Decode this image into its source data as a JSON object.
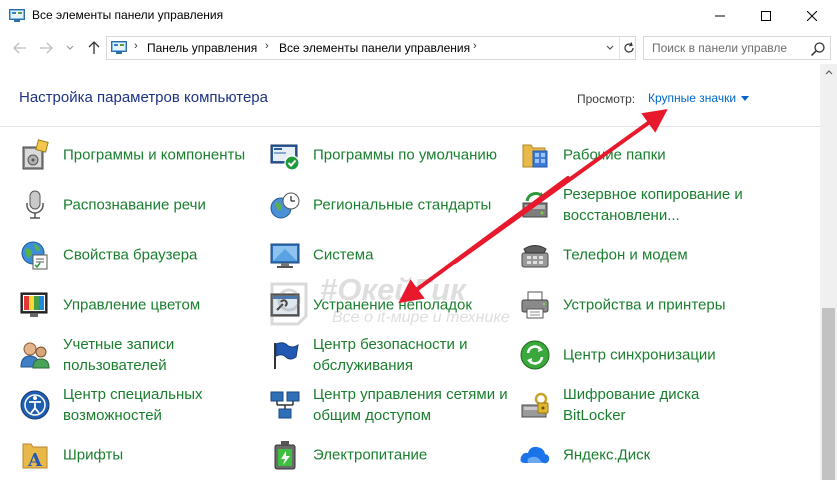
{
  "window": {
    "title": "Все элементы панели управления"
  },
  "address": {
    "crumbs": [
      "Панель управления",
      "Все элементы панели управления"
    ],
    "search_placeholder": "Поиск в панели управле"
  },
  "header": {
    "title": "Настройка параметров компьютера",
    "view_label": "Просмотр:",
    "view_value": "Крупные значки"
  },
  "items": [
    {
      "label": "Программы и компоненты",
      "icon": "programs-features-icon"
    },
    {
      "label": "Программы по умолчанию",
      "icon": "default-programs-icon"
    },
    {
      "label": "Рабочие папки",
      "icon": "work-folders-icon"
    },
    {
      "label": "Распознавание речи",
      "icon": "microphone-icon"
    },
    {
      "label": "Региональные стандарты",
      "icon": "region-clock-globe-icon"
    },
    {
      "label": "Резервное копирование и восстановлени...",
      "icon": "backup-restore-icon"
    },
    {
      "label": "Свойства браузера",
      "icon": "internet-options-icon"
    },
    {
      "label": "Система",
      "icon": "system-monitor-icon"
    },
    {
      "label": "Телефон и модем",
      "icon": "phone-modem-icon"
    },
    {
      "label": "Управление цветом",
      "icon": "color-management-icon"
    },
    {
      "label": "Устранение неполадок",
      "icon": "troubleshooting-icon"
    },
    {
      "label": "Устройства и принтеры",
      "icon": "devices-printers-icon"
    },
    {
      "label": "Учетные записи пользователей",
      "icon": "user-accounts-icon"
    },
    {
      "label": "Центр безопасности и обслуживания",
      "icon": "security-flag-icon"
    },
    {
      "label": "Центр синхронизации",
      "icon": "sync-center-icon"
    },
    {
      "label": "Центр специальных возможностей",
      "icon": "ease-of-access-icon"
    },
    {
      "label": "Центр управления сетями и общим доступом",
      "icon": "network-center-icon"
    },
    {
      "label": "Шифрование диска BitLocker",
      "icon": "bitlocker-icon"
    },
    {
      "label": "Шрифты",
      "icon": "fonts-icon"
    },
    {
      "label": "Электропитание",
      "icon": "power-options-icon"
    },
    {
      "label": "Яндекс.Диск",
      "icon": "yandex-disk-icon"
    }
  ],
  "watermark": {
    "main": "#ОкейГик",
    "sub": "Все о it-мире и технике"
  },
  "colors": {
    "link_green": "#1a7e2f",
    "title_blue": "#1e3287",
    "view_blue": "#0066cc",
    "arrow_red": "#e8192c"
  }
}
